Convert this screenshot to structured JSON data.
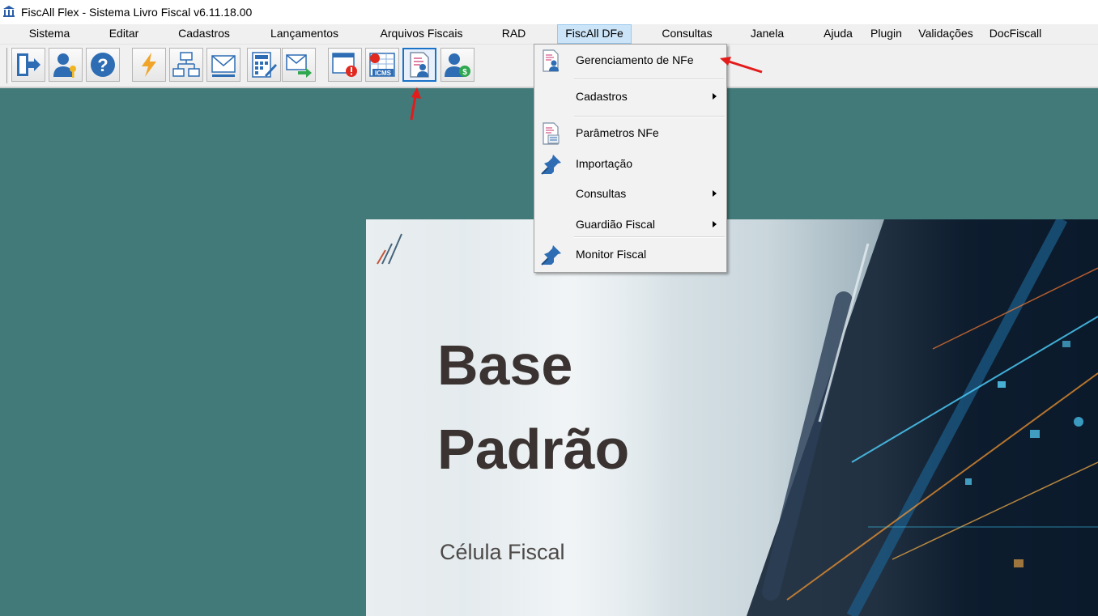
{
  "window": {
    "title": "FiscAll Flex - Sistema Livro Fiscal v6.11.18.00",
    "app_icon": "bank-building-icon"
  },
  "menubar": {
    "items": [
      {
        "label": "Sistema"
      },
      {
        "label": "Editar"
      },
      {
        "label": "Cadastros"
      },
      {
        "label": "Lançamentos"
      },
      {
        "label": "Arquivos Fiscais"
      },
      {
        "label": "RAD"
      },
      {
        "label": "FiscAll DFe",
        "active": true
      },
      {
        "label": "Consultas"
      },
      {
        "label": "Janela"
      },
      {
        "label": "Ajuda"
      },
      {
        "label": "Plugin"
      },
      {
        "label": "Validações"
      },
      {
        "label": "DocFiscall"
      }
    ]
  },
  "toolbar": {
    "buttons": [
      {
        "icon": "exit-door-icon"
      },
      {
        "icon": "user-key-icon"
      },
      {
        "icon": "help-icon"
      },
      {
        "icon": "lightning-icon"
      },
      {
        "icon": "org-chart-icon"
      },
      {
        "icon": "envelope-icon"
      },
      {
        "icon": "calculator-edit-icon"
      },
      {
        "icon": "send-mail-icon"
      },
      {
        "icon": "window-alert-icon"
      },
      {
        "icon": "icms-grid-icon",
        "badge_text": "ICMS"
      },
      {
        "icon": "nfe-management-icon",
        "selected": true
      },
      {
        "icon": "user-money-icon"
      }
    ]
  },
  "dropdown": {
    "items": [
      {
        "label": "Gerenciamento de NFe",
        "icon": "document-user-icon",
        "submenu": false,
        "highlighted": true
      },
      {
        "label": "Cadastros",
        "icon": null,
        "submenu": true
      },
      {
        "label": "Parâmetros NFe",
        "icon": "document-settings-icon",
        "submenu": false
      },
      {
        "label": "Importação",
        "icon": "pushpin-icon",
        "submenu": false
      },
      {
        "label": "Consultas",
        "icon": null,
        "submenu": true
      },
      {
        "label": "Guardião Fiscal",
        "icon": null,
        "submenu": true
      },
      {
        "label": "Monitor Fiscal",
        "icon": "pushpin-icon",
        "submenu": false
      }
    ]
  },
  "banner": {
    "title_line1": "Base",
    "title_line2": "Padrão",
    "subtitle": "Célula Fiscal"
  },
  "colors": {
    "workspace": "#417a79",
    "menu_active": "#cce4f7",
    "toolbar_selected_border": "#1a73c8",
    "annotation_arrow": "#e31b1b"
  }
}
